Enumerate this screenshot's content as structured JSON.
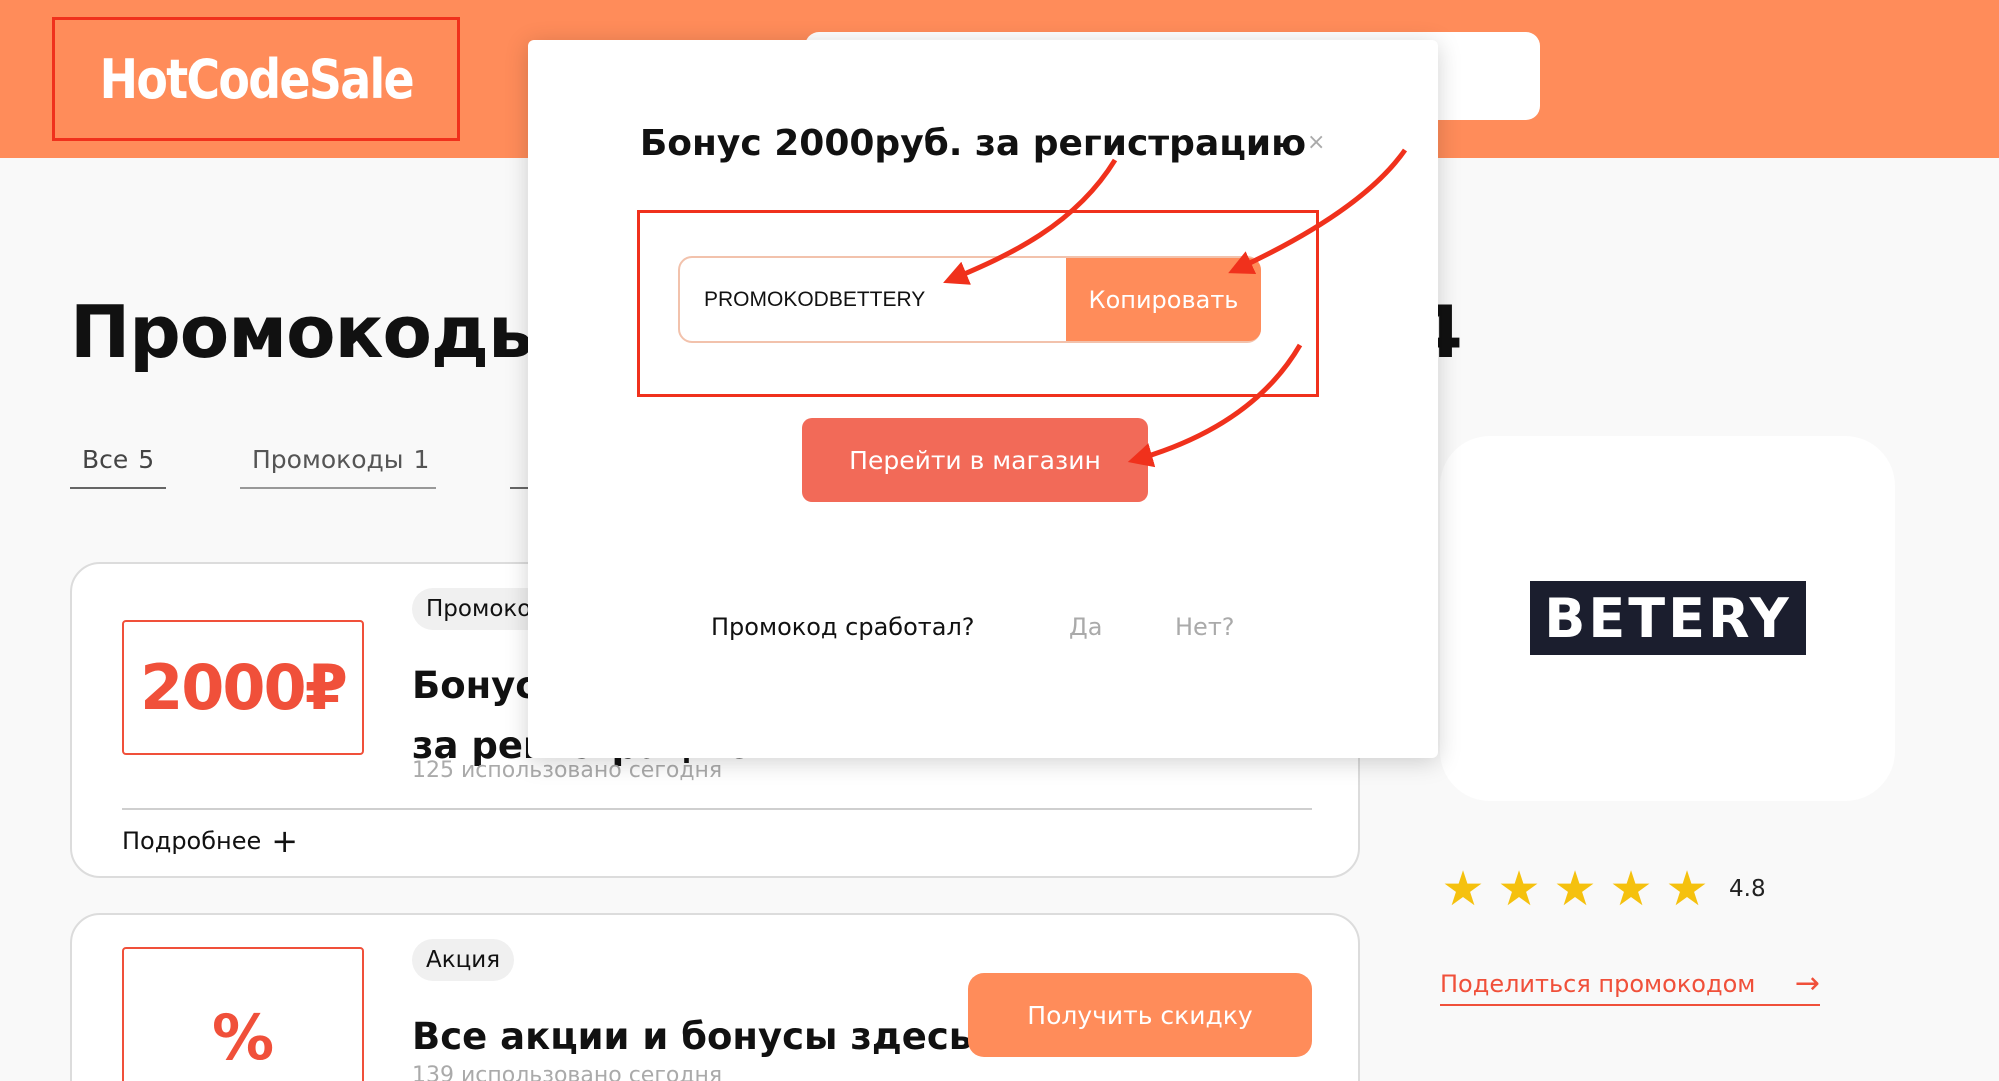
{
  "header": {
    "logo_text": "HotCodeSale"
  },
  "page": {
    "title": "Промокоды Betery на август 2024"
  },
  "tabs": [
    {
      "label": "Все",
      "count": "5"
    },
    {
      "label": "Промокоды",
      "count": "1"
    }
  ],
  "offers": [
    {
      "value": "2000₽",
      "badge": "Промокод",
      "title": "Бонус 2000руб. за регистрацию",
      "usage": "125 использовано сегодня",
      "more_label": "Подробнее",
      "more_icon": "plus-icon"
    },
    {
      "value": "%",
      "badge": "Акция",
      "title": "Все акции и бонусы здесь!",
      "usage": "139 использовано сегодня",
      "button_label": "Получить скидку"
    }
  ],
  "shop": {
    "logo_text": "BETERY",
    "rating_value": 4.8,
    "rating_stars": 5,
    "rating_label": "4.8",
    "share_label": "Поделиться промокодом",
    "share_icon": "arrow-right-icon"
  },
  "modal": {
    "title": "Бонус 2000руб. за регистрацию",
    "close_icon": "close-icon",
    "close_glyph": "×",
    "promo_code": "PROMOKODBETTERY",
    "copy_label": "Копировать",
    "goto_label": "Перейти в магазин",
    "feedback_question": "Промокод сработал?",
    "feedback_yes": "Да",
    "feedback_no": "Нет?"
  },
  "colors": {
    "brand_orange": "#ff8c5a",
    "accent_red": "#f0503a",
    "annotation_red": "#f0311c",
    "star_yellow": "#f5c10e"
  }
}
